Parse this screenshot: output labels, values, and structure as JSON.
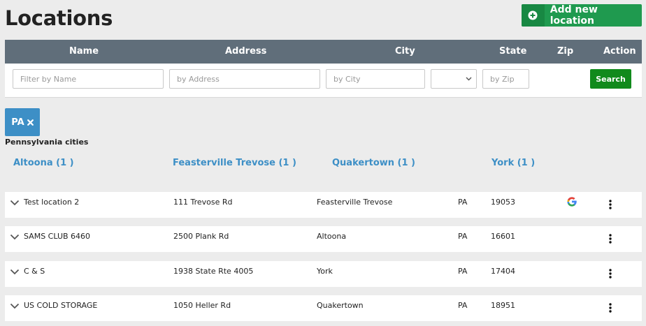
{
  "page": {
    "title": "Locations"
  },
  "actions": {
    "add_label": "Add new location"
  },
  "table": {
    "columns": {
      "name": "Name",
      "address": "Address",
      "city": "City",
      "state": "State",
      "zip": "Zip",
      "action": "Action"
    }
  },
  "filters": {
    "name_placeholder": "Filter by Name",
    "address_placeholder": "by Address",
    "city_placeholder": "by City",
    "state_value": "",
    "zip_placeholder": "by Zip",
    "search_label": "Search"
  },
  "active_filter": {
    "label": "PA"
  },
  "cities_section": {
    "title": "Pennsylvania cities",
    "links": [
      "Altoona (1 )",
      "Feasterville Trevose (1 )",
      "Quakertown (1 )",
      "York (1 )"
    ]
  },
  "rows": [
    {
      "name": "Test location 2",
      "address": "111 Trevose Rd",
      "city": "Feasterville Trevose",
      "state": "PA",
      "zip": "19053",
      "google": true
    },
    {
      "name": "SAMS CLUB 6460",
      "address": "2500 Plank Rd",
      "city": "Altoona",
      "state": "PA",
      "zip": "16601",
      "google": false
    },
    {
      "name": "C & S",
      "address": "1938 State Rte 4005",
      "city": "York",
      "state": "PA",
      "zip": "17404",
      "google": false
    },
    {
      "name": "US COLD STORAGE",
      "address": "1050 Heller Rd",
      "city": "Quakertown",
      "state": "PA",
      "zip": "18951",
      "google": false
    }
  ],
  "colors": {
    "accent": "#3d8fc6",
    "header": "#606e7a",
    "add": "#1f9a4f",
    "search": "#118a1c"
  },
  "icons": {
    "add": "plus-circle-icon",
    "chip_remove": "close-icon",
    "expand": "chevron-down-icon",
    "menu": "kebab-icon",
    "google": "google-icon"
  }
}
